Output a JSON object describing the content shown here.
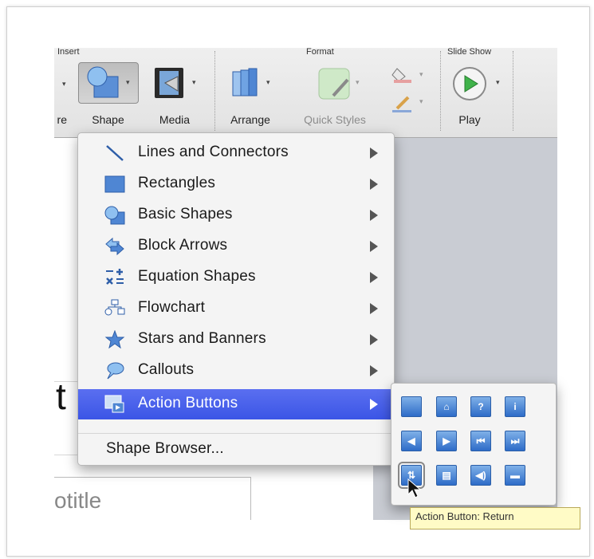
{
  "ribbon": {
    "groups": {
      "insert": "Insert",
      "format": "Format",
      "slideshow": "Slide Show"
    },
    "buttons": {
      "picture_partial": "re",
      "shape": "Shape",
      "media": "Media",
      "arrange": "Arrange",
      "quick_styles": "Quick Styles",
      "play": "Play"
    }
  },
  "slide": {
    "title_fragment": "t",
    "subtitle_fragment": "otitle"
  },
  "menu": {
    "items": [
      {
        "label": "Lines and Connectors",
        "icon": "line-icon"
      },
      {
        "label": "Rectangles",
        "icon": "rectangle-icon"
      },
      {
        "label": "Basic Shapes",
        "icon": "basic-shapes-icon"
      },
      {
        "label": "Block Arrows",
        "icon": "block-arrows-icon"
      },
      {
        "label": "Equation Shapes",
        "icon": "equation-icon"
      },
      {
        "label": "Flowchart",
        "icon": "flowchart-icon"
      },
      {
        "label": "Stars and Banners",
        "icon": "star-icon"
      },
      {
        "label": "Callouts",
        "icon": "callout-icon"
      },
      {
        "label": "Action Buttons",
        "icon": "action-buttons-icon",
        "selected": true
      }
    ],
    "shape_browser": "Shape Browser..."
  },
  "submenu": {
    "buttons": [
      {
        "name": "custom",
        "glyph": ""
      },
      {
        "name": "home",
        "glyph": "⌂"
      },
      {
        "name": "help",
        "glyph": "?"
      },
      {
        "name": "information",
        "glyph": "i"
      },
      {
        "name": "back",
        "glyph": "◀"
      },
      {
        "name": "forward",
        "glyph": "▶"
      },
      {
        "name": "beginning",
        "glyph": "⏮"
      },
      {
        "name": "end",
        "glyph": "⏭"
      },
      {
        "name": "return",
        "glyph": "⇅"
      },
      {
        "name": "document",
        "glyph": "▤"
      },
      {
        "name": "sound",
        "glyph": "◀)"
      },
      {
        "name": "movie",
        "glyph": "▬"
      }
    ],
    "tooltip": "Action Button: Return"
  },
  "colors": {
    "selection": "#3b55e6",
    "tooltip_bg": "#fffbc6",
    "action_button": "#2e6cc8"
  }
}
